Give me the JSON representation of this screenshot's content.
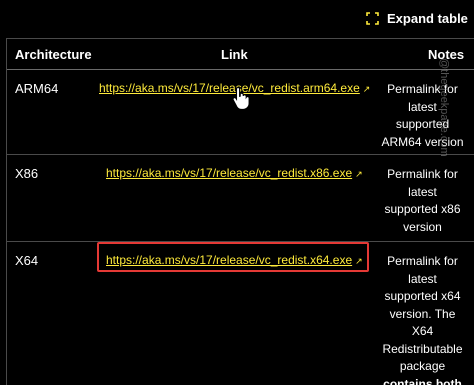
{
  "toolbar": {
    "expand_label": "Expand table",
    "expand_icon": "expand-icon"
  },
  "table": {
    "headers": {
      "architecture": "Architecture",
      "link": "Link",
      "notes": "Notes"
    },
    "rows": [
      {
        "architecture": "ARM64",
        "link": "https://aka.ms/vs/17/release/vc_redist.arm64.exe",
        "notes": [
          "Permalink for",
          "latest",
          "supported",
          "ARM64 version"
        ]
      },
      {
        "architecture": "X86",
        "link": "https://aka.ms/vs/17/release/vc_redist.x86.exe",
        "notes": [
          "Permalink for",
          "latest",
          "supported x86",
          "version"
        ]
      },
      {
        "architecture": "X64",
        "link": "https://aka.ms/vs/17/release/vc_redist.x64.exe",
        "notes": [
          "Permalink for",
          "latest",
          "supported x64",
          "version. The",
          "X64",
          "Redistributable",
          "package",
          "contains both"
        ]
      }
    ]
  },
  "watermark": "@thegeekpage.com",
  "colors": {
    "link": "#ffeb3b",
    "highlight": "#e53935",
    "background": "#000000"
  }
}
